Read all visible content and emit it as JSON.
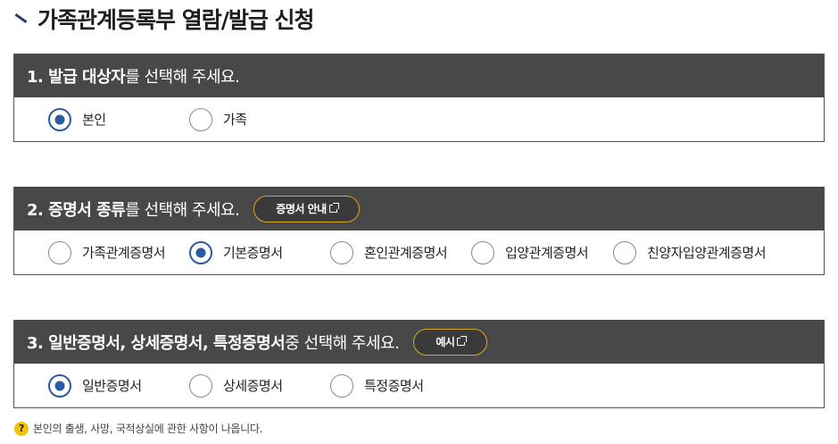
{
  "page": {
    "title": "가족관계등록부 열람/발급 신청"
  },
  "section1": {
    "head_strong": "1. 발급 대상자",
    "head_plain": "를 선택해 주세요.",
    "options": [
      {
        "label": "본인",
        "checked": true
      },
      {
        "label": "가족",
        "checked": false
      }
    ]
  },
  "section2": {
    "head_strong": "2. 증명서 종류",
    "head_plain": "를 선택해 주세요.",
    "guide_button": "증명서 안내",
    "options": [
      {
        "label": "가족관계증명서",
        "checked": false
      },
      {
        "label": "기본증명서",
        "checked": true
      },
      {
        "label": "혼인관계증명서",
        "checked": false
      },
      {
        "label": "입양관계증명서",
        "checked": false
      },
      {
        "label": "친양자입양관계증명서",
        "checked": false
      }
    ]
  },
  "section3": {
    "head_strong": "3. 일반증명서, 상세증명서, 특정증명서",
    "head_plain": " 중 선택해 주세요.",
    "example_button": "예시",
    "options": [
      {
        "label": "일반증명서",
        "checked": true
      },
      {
        "label": "상세증명서",
        "checked": false
      },
      {
        "label": "특정증명서",
        "checked": false
      }
    ]
  },
  "note": {
    "icon": "question-icon",
    "icon_glyph": "?",
    "text": "본인의 출생, 사망, 국적상실에 관한 사항이 나옵니다."
  },
  "colors": {
    "header_bg": "#484848",
    "radio_checked": "#2c5aa0",
    "button_border": "#d8a822",
    "note_icon": "#f2c20a"
  }
}
